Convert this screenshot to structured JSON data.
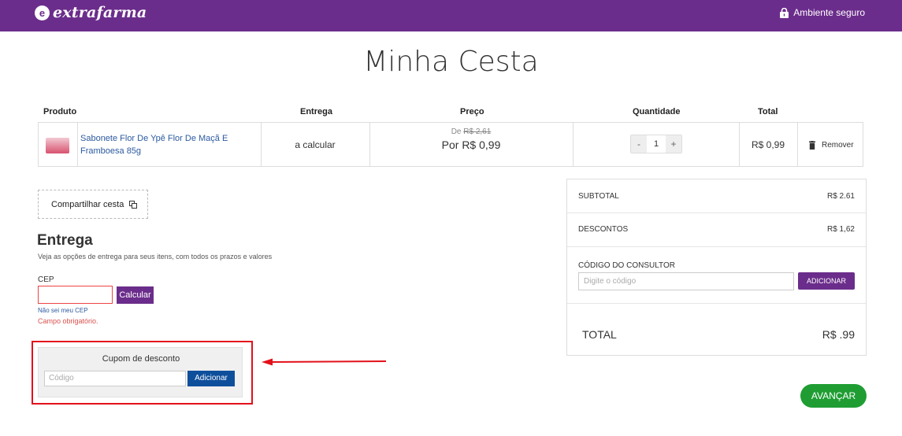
{
  "header": {
    "logo_mark": "e",
    "logo_text": "extrafarma",
    "secure_label": "Ambiente seguro"
  },
  "page_title": "Minha Cesta",
  "table": {
    "headers": {
      "produto": "Produto",
      "entrega": "Entrega",
      "preco": "Preço",
      "quantidade": "Quantidade",
      "total": "Total"
    },
    "item": {
      "name": "Sabonete Flor De Ypê Flor De Maçã E Framboesa 85g",
      "entrega": "a calcular",
      "de_prefix": "De",
      "de_price": "R$ 2,61",
      "por_price": "Por R$ 0,99",
      "decrement": "-",
      "quantity": "1",
      "increment": "+",
      "total": "R$ 0,99",
      "remove_label": "Remover"
    }
  },
  "share_label": "Compartilhar cesta",
  "entrega": {
    "heading": "Entrega",
    "subtitle": "Veja as opções de entrega para seus itens, com todos os prazos e valores",
    "cep_label": "CEP",
    "cep_value": "",
    "calc_button": "Calcular",
    "nao_sei": "Não sei meu CEP",
    "error": "Campo obrigatório."
  },
  "cupom": {
    "title": "Cupom de desconto",
    "placeholder": "Código",
    "button": "Adicionar"
  },
  "summary": {
    "subtotal_label": "SUBTOTAL",
    "subtotal_value": "R$ 2.61",
    "descontos_label": "DESCONTOS",
    "descontos_value": "R$ 1,62",
    "consultor_label": "CÓDIGO DO CONSULTOR",
    "consultor_placeholder": "Digite o código",
    "consultor_button": "ADICIONAR",
    "total_label": "TOTAL",
    "total_value": "R$ .99"
  },
  "avancar_label": "AVANÇAR",
  "colors": {
    "brand_purple": "#6b2d8b",
    "link_blue": "#2c5aa0",
    "button_blue": "#0e4f9c",
    "success_green": "#1f9d33",
    "error_red": "#d9534f",
    "annotation_red": "#e3101a"
  }
}
